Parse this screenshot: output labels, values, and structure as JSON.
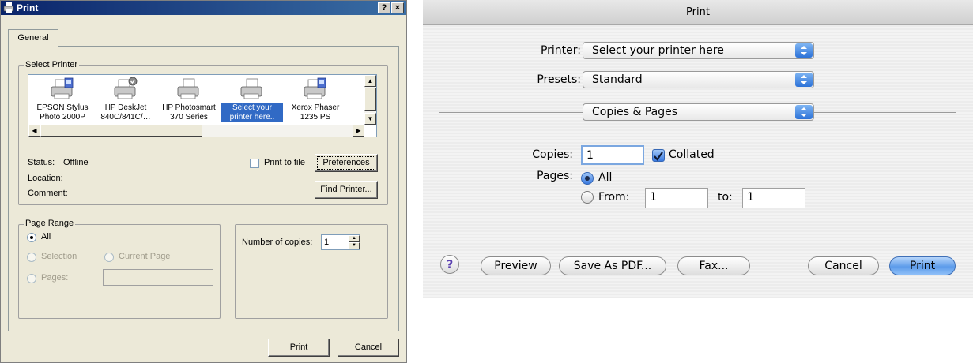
{
  "windows_dialog": {
    "title": "Print",
    "title_buttons": {
      "help": "?",
      "close": "×"
    },
    "tab": "General",
    "select_printer": {
      "legend": "Select Printer",
      "printers": [
        {
          "line1": "EPSON Stylus",
          "line2": "Photo 2000P",
          "icon": "network-printer-icon"
        },
        {
          "line1": "HP DeskJet",
          "line2": "840C/841C/…",
          "icon": "default-printer-icon"
        },
        {
          "line1": "HP Photosmart",
          "line2": "370 Series",
          "icon": "printer-icon"
        },
        {
          "line1": "Select your",
          "line2": "printer here..",
          "icon": "printer-icon"
        },
        {
          "line1": "Xerox Phaser",
          "line2": "1235 PS",
          "icon": "network-printer-icon"
        }
      ],
      "status_label": "Status:",
      "status_value": "Offline",
      "location_label": "Location:",
      "comment_label": "Comment:",
      "print_to_file": "Print to file",
      "preferences": "Preferences",
      "find_printer": "Find Printer..."
    },
    "page_range": {
      "legend": "Page Range",
      "all": "All",
      "selection": "Selection",
      "current_page": "Current Page",
      "pages": "Pages:"
    },
    "copies": {
      "label": "Number of copies:",
      "value": "1"
    },
    "buttons": {
      "print": "Print",
      "cancel": "Cancel"
    }
  },
  "mac_dialog": {
    "title": "Print",
    "printer_label": "Printer:",
    "printer_value": "Select your printer here",
    "presets_label": "Presets:",
    "presets_value": "Standard",
    "section_value": "Copies & Pages",
    "copies_label": "Copies:",
    "copies_value": "1",
    "collated": "Collated",
    "pages_label": "Pages:",
    "all": "All",
    "from": "From:",
    "from_value": "1",
    "to": "to:",
    "to_value": "1",
    "help": "?",
    "buttons": {
      "preview": "Preview",
      "save_as_pdf": "Save As PDF...",
      "fax": "Fax...",
      "cancel": "Cancel",
      "print": "Print"
    },
    "accent_color": "#3a7ae0"
  }
}
